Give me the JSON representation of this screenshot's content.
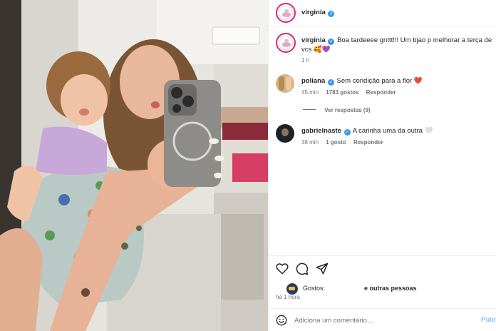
{
  "header": {
    "username": "virginia",
    "avatar_icon": "virginia-avatar-logo-icon"
  },
  "caption": {
    "username": "virginia",
    "text": "Boa tardeeee gnttt!!! Um bjao p melhorar a terça de vcs",
    "emoji": "🥰💜",
    "time": "1 h"
  },
  "comments": [
    {
      "username": "poliana",
      "text": "Sem condição para a flor",
      "emoji": "❤️",
      "time": "45 min",
      "likes": "1783 gostos",
      "reply": "Responder"
    },
    {
      "username": "gabrielnaste",
      "text": "A carinha uma da outra",
      "emoji": "🤍",
      "time": "38 min",
      "likes": "1 gosto",
      "reply": "Responder"
    }
  ],
  "view_replies": "Ver respostas (9)",
  "actions": {
    "like_icon": "heart-icon",
    "comment_icon": "comment-icon",
    "share_icon": "share-icon"
  },
  "likes_summary": {
    "label": "Gostos:",
    "others": "e outras pessoas"
  },
  "post_time": "há 1 hora",
  "comment_box": {
    "placeholder": "Adiciona um comentário...",
    "publish": "Publi",
    "emoji_icon": "smiley-icon"
  },
  "colors": {
    "verified": "#3897f0",
    "link": "#0095f6",
    "heart": "#ed4956",
    "story_ring": "#d62976"
  }
}
